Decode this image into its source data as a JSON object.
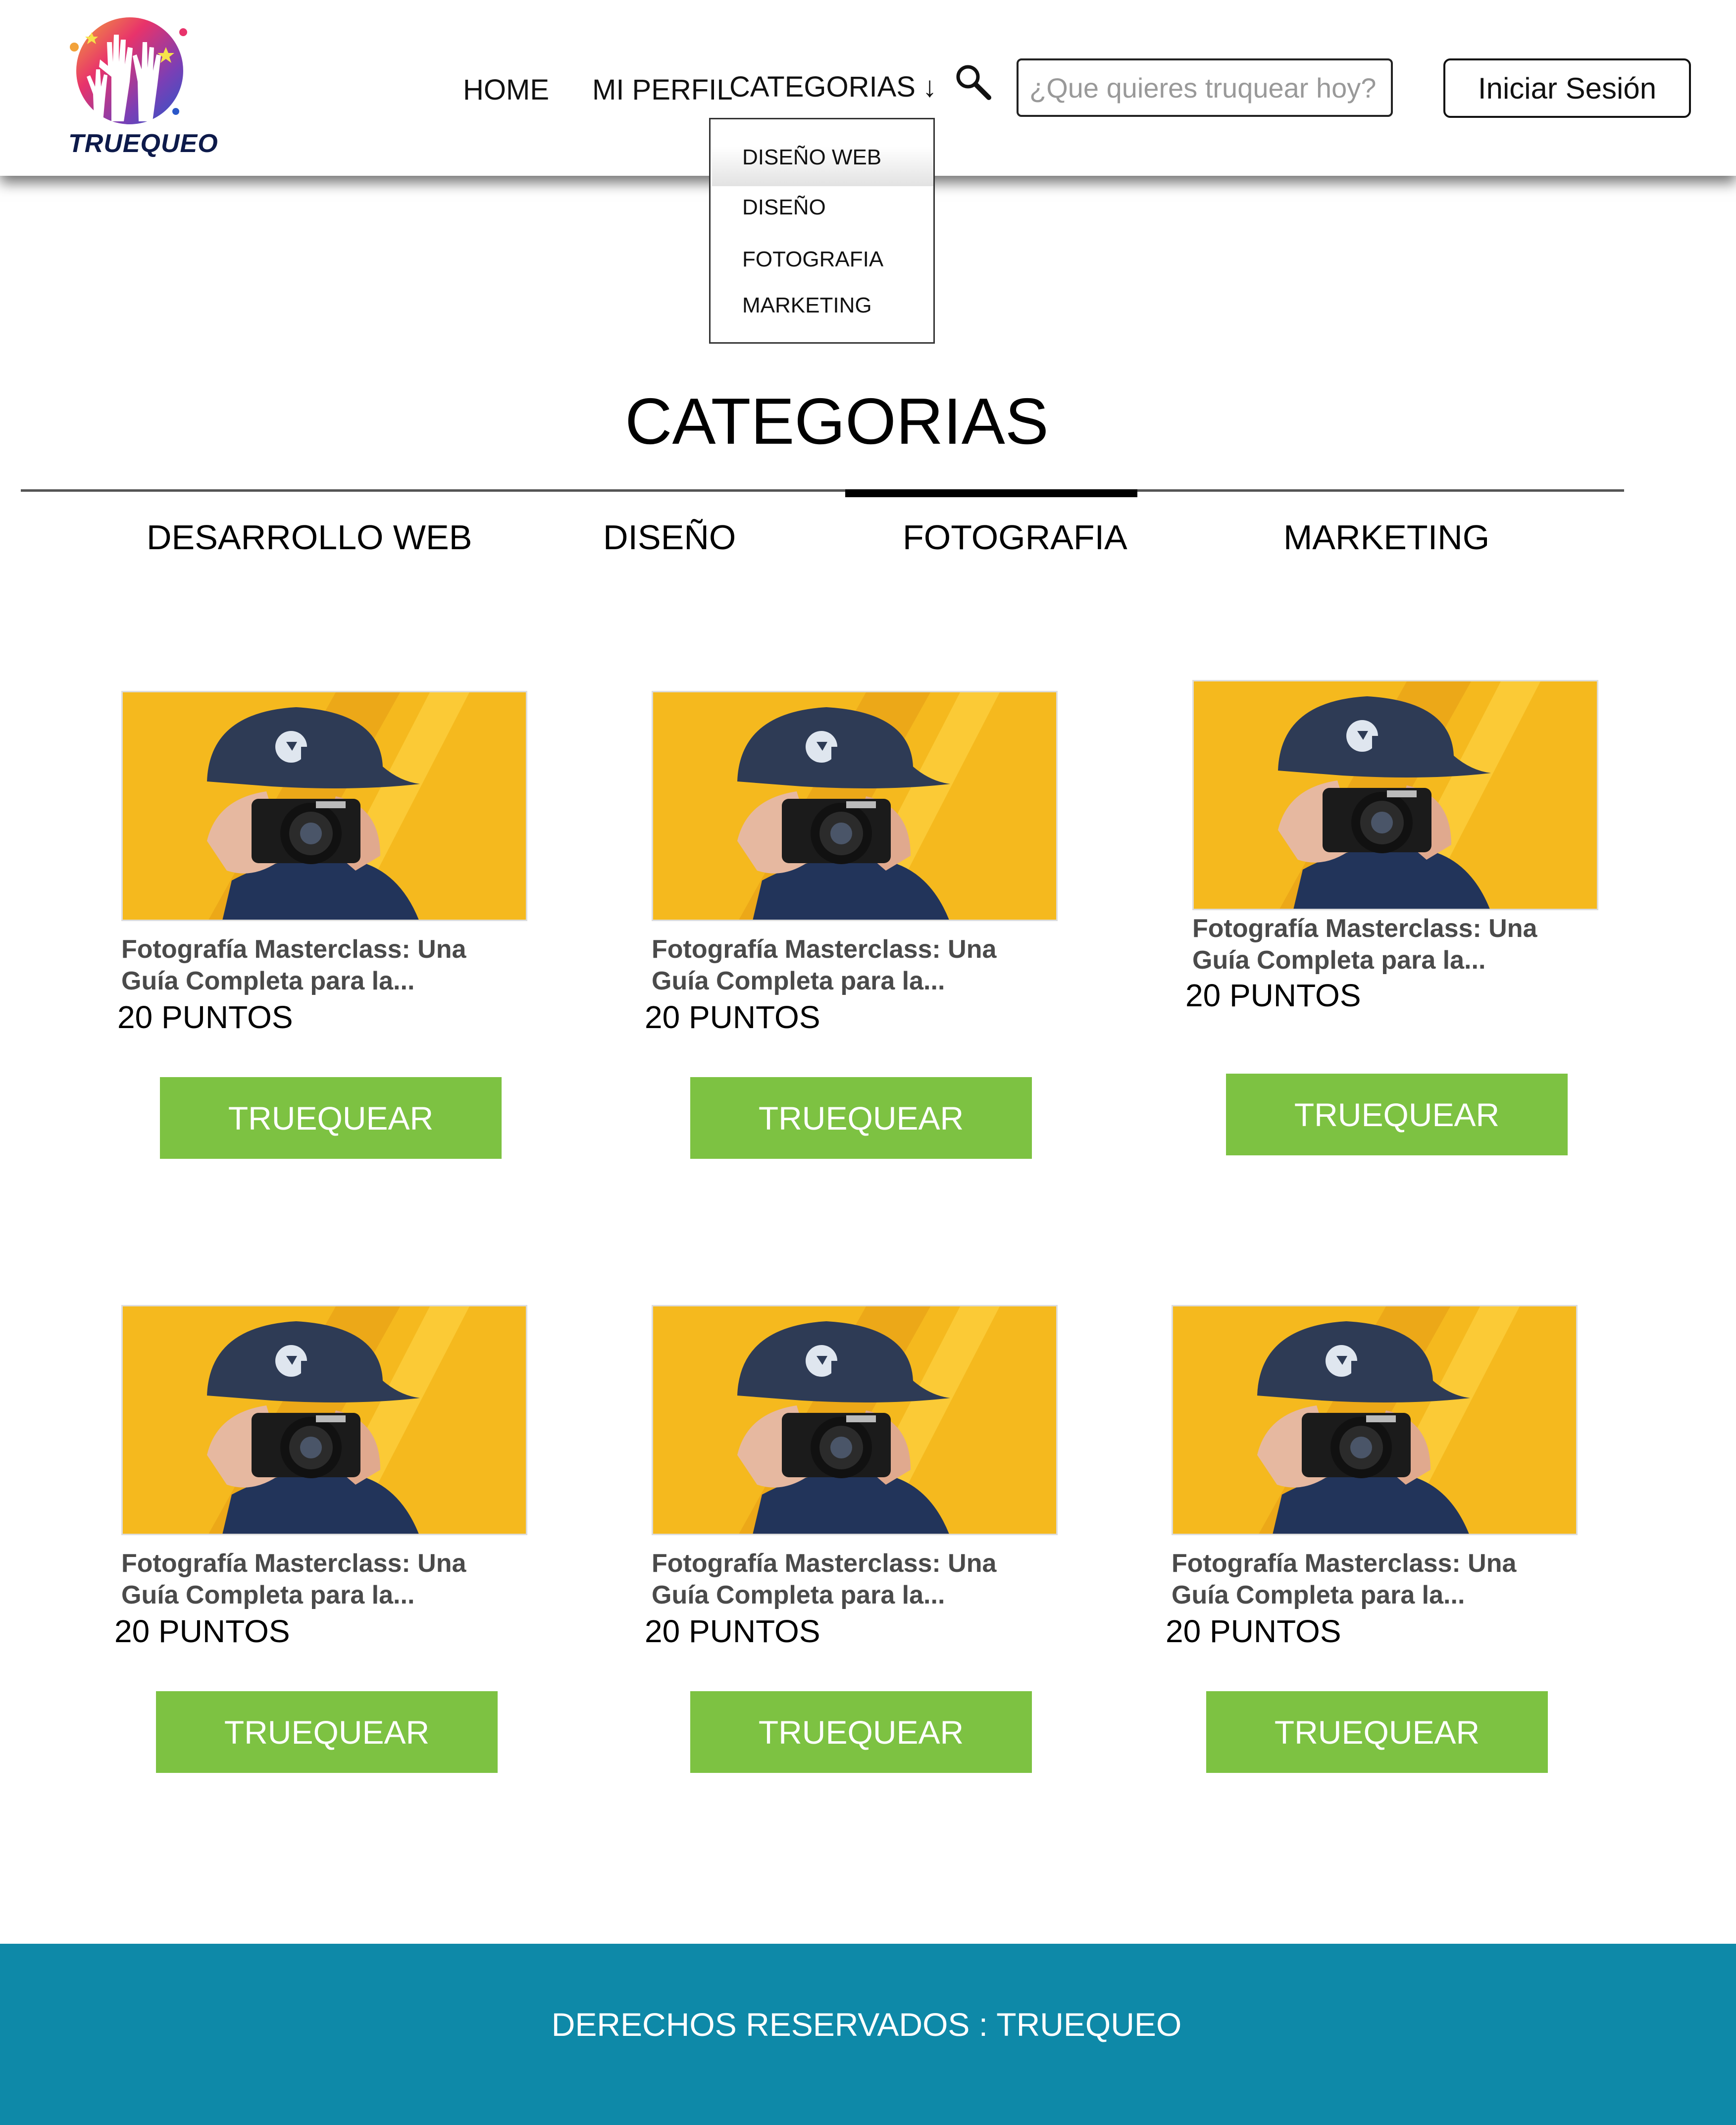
{
  "brand": {
    "name": "TRUEQUEO"
  },
  "nav": {
    "home": "HOME",
    "profile": "MI PERFIL",
    "categories": "CATEGORIAS",
    "categories_arrow": "↓"
  },
  "search": {
    "placeholder": "¿Que quieres truquear hoy?",
    "icon": "search-icon"
  },
  "login": {
    "label": "Iniciar Sesión"
  },
  "dropdown": {
    "items": [
      "DISEÑO WEB",
      "DISEÑO",
      "FOTOGRAFIA",
      "MARKETING"
    ]
  },
  "page": {
    "title": "CATEGORIAS"
  },
  "tabs": {
    "items": [
      "DESARROLLO WEB",
      "DISEÑO",
      "FOTOGRAFIA",
      "MARKETING"
    ],
    "active": "FOTOGRAFIA"
  },
  "courses": [
    {
      "title_line1": "Fotografía Masterclass: Una",
      "title_line2": "Guía Completa para la...",
      "points": "20 PUNTOS",
      "button": "TRUEQUEAR"
    },
    {
      "title_line1": "Fotografía Masterclass: Una",
      "title_line2": "Guía Completa para la...",
      "points": "20 PUNTOS",
      "button": "TRUEQUEAR"
    },
    {
      "title_line1": "Fotografía Masterclass: Una",
      "title_line2": "Guía Completa para la...",
      "points": "20 PUNTOS",
      "button": "TRUEQUEAR"
    },
    {
      "title_line1": "Fotografía Masterclass: Una",
      "title_line2": "Guía Completa para la...",
      "points": "20 PUNTOS",
      "button": "TRUEQUEAR"
    },
    {
      "title_line1": "Fotografía Masterclass: Una",
      "title_line2": "Guía Completa para la...",
      "points": "20 PUNTOS",
      "button": "TRUEQUEAR"
    },
    {
      "title_line1": "Fotografía Masterclass: Una",
      "title_line2": "Guía Completa para la...",
      "points": "20 PUNTOS",
      "button": "TRUEQUEAR"
    }
  ],
  "footer": {
    "text": "DERECHOS RESERVADOS : TRUEQUEO"
  },
  "colors": {
    "accent_button": "#7dc242",
    "footer_bg": "#0e89a8",
    "image_bg": "#f5b91e"
  }
}
